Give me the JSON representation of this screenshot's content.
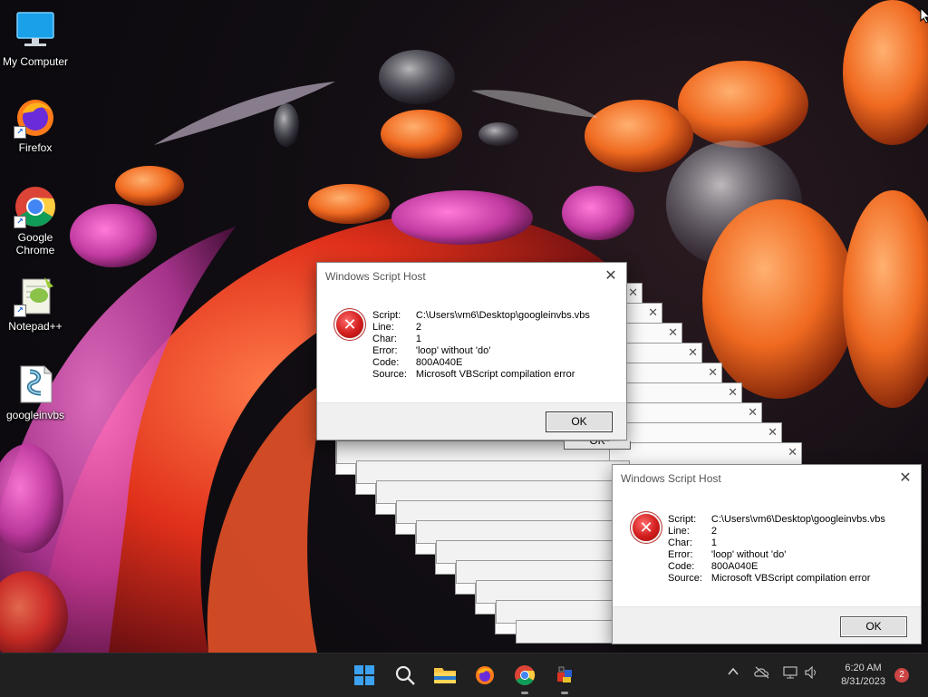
{
  "desktop": {
    "icons": [
      {
        "label": "My Computer"
      },
      {
        "label": "Firefox"
      },
      {
        "label": "Google Chrome"
      },
      {
        "label": "Notepad++"
      },
      {
        "label": "googleinvbs"
      }
    ]
  },
  "dialog": {
    "title": "Windows Script Host",
    "fields": [
      {
        "label": "Script:",
        "value": "C:\\Users\\vm6\\Desktop\\googleinvbs.vbs"
      },
      {
        "label": "Line:",
        "value": "2"
      },
      {
        "label": "Char:",
        "value": "1"
      },
      {
        "label": "Error:",
        "value": "'loop' without 'do'"
      },
      {
        "label": "Code:",
        "value": "800A040E"
      },
      {
        "label": "Source:",
        "value": "Microsoft VBScript compilation error"
      }
    ],
    "ok_label": "OK",
    "close_glyph": "✕",
    "behind_ok_label": "OK"
  },
  "taskbar": {
    "time": "6:20 AM",
    "date": "8/31/2023",
    "notification_count": "2",
    "apps": [
      "start-icon",
      "search-icon",
      "file-explorer-icon",
      "firefox-icon",
      "chrome-icon",
      "app-icon"
    ]
  }
}
